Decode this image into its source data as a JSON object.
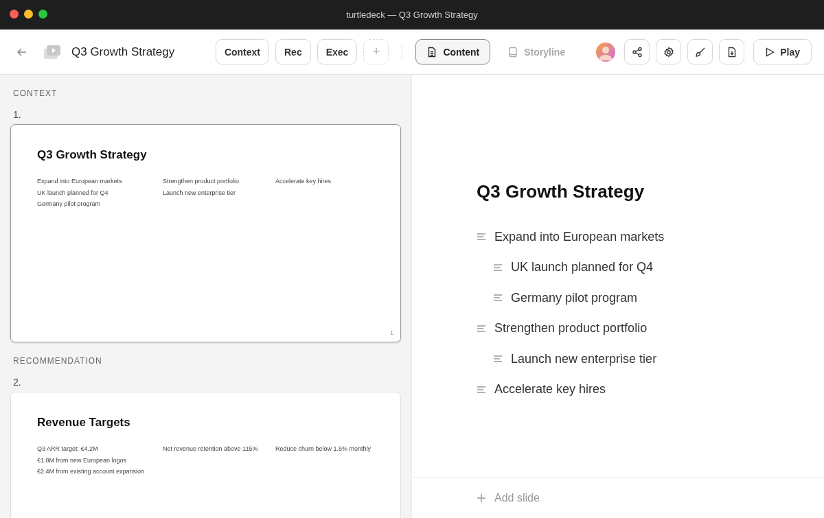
{
  "window": {
    "title": "turtledeck — Q3 Growth Strategy"
  },
  "header": {
    "deck_title": "Q3 Growth Strategy",
    "section_buttons": [
      {
        "label": "Context"
      },
      {
        "label": "Rec"
      },
      {
        "label": "Exec"
      }
    ],
    "add_section": "+",
    "views": [
      {
        "label": "Content",
        "kind": "document",
        "selected": true
      },
      {
        "label": "Storyline",
        "kind": "book",
        "selected": false
      }
    ],
    "actions": [
      {
        "kind": "share"
      },
      {
        "kind": "settings"
      },
      {
        "kind": "brush"
      },
      {
        "kind": "download"
      }
    ],
    "play": "Play"
  },
  "slides": [
    {
      "section": "CONTEXT",
      "number": "1.",
      "title": "Q3 Growth Strategy",
      "selected": true,
      "page_number": "1",
      "columns": [
        {
          "items": [
            {
              "text": "Expand into European markets"
            },
            {
              "text": "UK launch planned for Q4"
            },
            {
              "text": "Germany pilot program"
            }
          ]
        },
        {
          "items": [
            {
              "text": "Strengthen product portfolio"
            },
            {
              "text": "Launch new enterprise tier"
            }
          ]
        },
        {
          "items": [
            {
              "text": "Accelerate key hires"
            }
          ]
        }
      ]
    },
    {
      "section": "RECOMMENDATION",
      "number": "2.",
      "title": "Revenue Targets",
      "selected": false,
      "columns": [
        {
          "items": [
            {
              "text": "Q3 ARR target: €4.2M"
            },
            {
              "text": "€1.8M from new European logos"
            },
            {
              "text": "€2.4M from existing account expansion"
            }
          ]
        },
        {
          "items": [
            {
              "text": "Net revenue retention above 115%"
            }
          ]
        },
        {
          "items": [
            {
              "text": "Reduce churn below 1.5% monthly"
            }
          ]
        }
      ]
    }
  ],
  "editor": {
    "title": "Q3 Growth Strategy",
    "outline": [
      {
        "text": "Expand into European markets",
        "children": [
          {
            "text": "UK launch planned for Q4"
          },
          {
            "text": "Germany pilot program"
          }
        ]
      },
      {
        "text": "Strengthen product portfolio",
        "children": [
          {
            "text": "Launch new enterprise tier"
          }
        ]
      },
      {
        "text": "Accelerate key hires"
      }
    ],
    "add_slide": "Add slide"
  }
}
